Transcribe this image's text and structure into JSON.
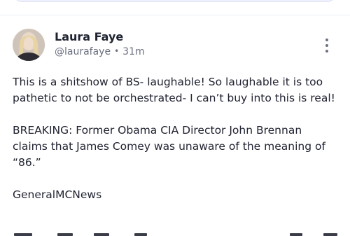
{
  "post": {
    "author": {
      "name": "Laura Faye",
      "handle": "@laurafaye",
      "time": "31m"
    },
    "paragraphs": [
      "This is a shitshow of BS- laughable! So laughable it is too pathetic to not be orchestrated- I can’t buy into this is real!",
      "BREAKING: Former Obama CIA Director John Brennan claims that James Comey was unaware of the meaning of “86.”",
      "GeneralMCNews"
    ]
  },
  "icons": {
    "more": "more-vertical-icon",
    "avatar": "profile-photo"
  },
  "colors": {
    "text": "#1f2230",
    "muted": "#6c7180",
    "divider": "#eceef3",
    "input_bg": "#eef0fb"
  }
}
